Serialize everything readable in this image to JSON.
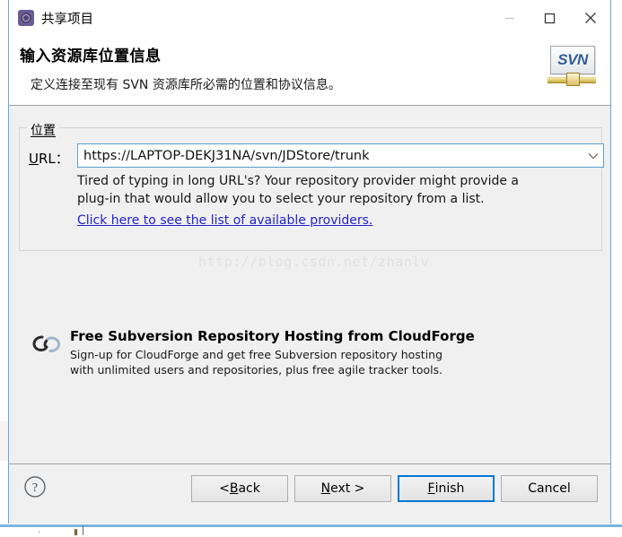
{
  "window": {
    "title": "共享项目",
    "icon": "share-project-icon",
    "controls": {
      "minimize": "minimize-icon",
      "maximize": "maximize-icon",
      "close": "close-icon"
    }
  },
  "header": {
    "title": "输入资源库位置信息",
    "description": "定义连接至现有 SVN 资源库所必需的位置和协议信息。",
    "logo_text": "SVN"
  },
  "location_group": {
    "legend": "位置",
    "url_label_prefix": "U",
    "url_label_rest": "RL：",
    "url_value": "https://LAPTOP-DEKJ31NA/svn/JDStore/trunk",
    "url_placeholder": "https://",
    "hint_line1": "Tired of typing in long URL's?  Your repository provider might provide a",
    "hint_line2": "plug-in that would allow you to select your repository from a list.",
    "providers_link": "Click here to see the list of available providers."
  },
  "watermark": {
    "text": "http://blog.csdn.net/zhanlv"
  },
  "cloudforge": {
    "icon": "cloud-icon",
    "title": "Free Subversion Repository Hosting from CloudForge",
    "desc_line1": "Sign-up for CloudForge and get free Subversion repository hosting",
    "desc_line2": "with unlimited users and repositories, plus free agile tracker tools."
  },
  "footer": {
    "help_icon": "help-icon",
    "buttons": [
      {
        "id": "back",
        "prefix": "< ",
        "accel": "B",
        "suffix": "ack",
        "default": false
      },
      {
        "id": "next",
        "prefix": "",
        "accel": "N",
        "suffix": "ext >",
        "default": false
      },
      {
        "id": "finish",
        "prefix": "",
        "accel": "F",
        "suffix": "inish",
        "default": true
      },
      {
        "id": "cancel",
        "prefix": "",
        "accel": "",
        "suffix": "Cancel",
        "default": false
      }
    ]
  },
  "colors": {
    "accent": "#0078d7",
    "dialog_bg": "#f0f0f0",
    "field_border": "#5aa0d0",
    "link": "#2222cc",
    "svn_blue": "#2f5c93",
    "svn_gold": "#c9a93d"
  }
}
